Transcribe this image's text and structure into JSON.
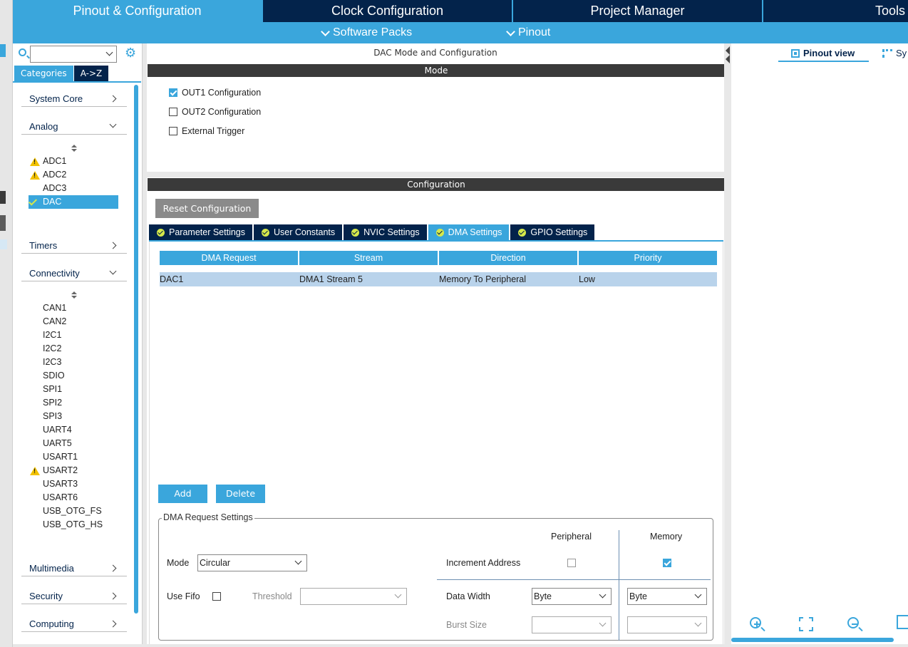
{
  "main_tabs": [
    {
      "label": "Pinout & Configuration",
      "active": true
    },
    {
      "label": "Clock Configuration",
      "active": false
    },
    {
      "label": "Project Manager",
      "active": false
    },
    {
      "label": "Tools",
      "active": false
    }
  ],
  "sub_menu": {
    "software_packs": "Software Packs",
    "pinout": "Pinout"
  },
  "left": {
    "search": {
      "value": ""
    },
    "tabs": {
      "categories": "Categories",
      "az": "A->Z"
    },
    "categories": {
      "system_core": "System Core",
      "analog": "Analog",
      "timers": "Timers",
      "connectivity": "Connectivity",
      "multimedia": "Multimedia",
      "security": "Security",
      "computing": "Computing"
    },
    "analog_items": [
      {
        "label": "ADC1",
        "status": "warning"
      },
      {
        "label": "ADC2",
        "status": "warning"
      },
      {
        "label": "ADC3",
        "status": "none"
      },
      {
        "label": "DAC",
        "status": "ok",
        "selected": true
      }
    ],
    "connectivity_items": [
      {
        "label": "CAN1",
        "status": "none"
      },
      {
        "label": "CAN2",
        "status": "none"
      },
      {
        "label": "I2C1",
        "status": "none"
      },
      {
        "label": "I2C2",
        "status": "none"
      },
      {
        "label": "I2C3",
        "status": "none"
      },
      {
        "label": "SDIO",
        "status": "none"
      },
      {
        "label": "SPI1",
        "status": "none"
      },
      {
        "label": "SPI2",
        "status": "none"
      },
      {
        "label": "SPI3",
        "status": "none"
      },
      {
        "label": "UART4",
        "status": "none"
      },
      {
        "label": "UART5",
        "status": "none"
      },
      {
        "label": "USART1",
        "status": "none"
      },
      {
        "label": "USART2",
        "status": "warning"
      },
      {
        "label": "USART3",
        "status": "none"
      },
      {
        "label": "USART6",
        "status": "none"
      },
      {
        "label": "USB_OTG_FS",
        "status": "none"
      },
      {
        "label": "USB_OTG_HS",
        "status": "none"
      }
    ]
  },
  "center": {
    "title": "DAC Mode and Configuration",
    "mode_bar": "Mode",
    "mode_options": [
      {
        "label": "OUT1 Configuration",
        "checked": true
      },
      {
        "label": "OUT2 Configuration",
        "checked": false
      },
      {
        "label": "External Trigger",
        "checked": false
      }
    ],
    "config_bar": "Configuration",
    "reset_button": "Reset Configuration",
    "config_tabs": [
      {
        "label": "Parameter Settings",
        "active": false
      },
      {
        "label": "User Constants",
        "active": false
      },
      {
        "label": "NVIC Settings",
        "active": false
      },
      {
        "label": "DMA Settings",
        "active": true
      },
      {
        "label": "GPIO Settings",
        "active": false
      }
    ],
    "dma_table": {
      "headers": [
        "DMA Request",
        "Stream",
        "Direction",
        "Priority"
      ],
      "rows": [
        [
          "DAC1",
          "DMA1 Stream 5",
          "Memory To Peripheral",
          "Low"
        ]
      ]
    },
    "add_button": "Add",
    "delete_button": "Delete",
    "dma_request_settings": {
      "legend": "DMA Request Settings",
      "peripheral_header": "Peripheral",
      "memory_header": "Memory",
      "mode_label": "Mode",
      "mode_value": "Circular",
      "increment_address_label": "Increment Address",
      "increment_peripheral": false,
      "increment_memory": true,
      "use_fifo_label": "Use Fifo",
      "use_fifo": false,
      "threshold_label": "Threshold",
      "threshold_value": "",
      "data_width_label": "Data Width",
      "data_width_peripheral": "Byte",
      "data_width_memory": "Byte",
      "burst_size_label": "Burst Size",
      "burst_peripheral": "",
      "burst_memory": ""
    }
  },
  "right": {
    "pinout_view": "Pinout view",
    "system_view": "Sy"
  },
  "colors": {
    "accent": "#3aa6dc",
    "navy": "#03234b",
    "bar_dark": "#3a3a3a",
    "warning": "#f2c200",
    "ok": "#d6e84a"
  }
}
